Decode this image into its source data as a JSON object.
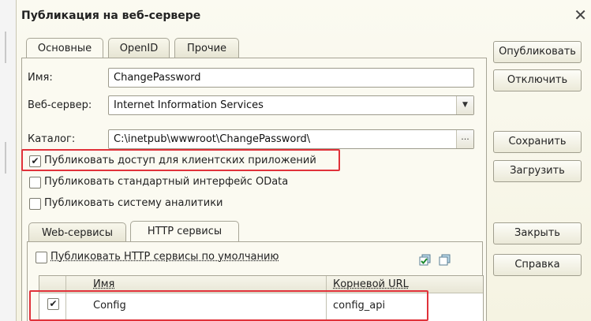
{
  "dialog": {
    "title": "Публикация на веб-сервере",
    "close_glyph": "✕"
  },
  "tabs": [
    {
      "label": "Основные",
      "active": true
    },
    {
      "label": "OpenID",
      "active": false
    },
    {
      "label": "Прочие",
      "active": false
    }
  ],
  "form": {
    "name_label": "Имя:",
    "name_value": "ChangePassword",
    "server_label": "Веб-сервер:",
    "server_value": "Internet Information Services",
    "catalog_label": "Каталог:",
    "catalog_value": "C:\\inetpub\\wwwroot\\ChangePassword\\",
    "ellipsis": "..."
  },
  "checkboxes": {
    "client_access": {
      "label": "Публиковать доступ для клиентских приложений",
      "checked": true
    },
    "odata": {
      "label": "Публиковать стандартный интерфейс OData",
      "checked": false
    },
    "analytics": {
      "label": "Публиковать систему аналитики",
      "checked": false
    }
  },
  "buttons": {
    "publish": "Опубликовать",
    "disable": "Отключить",
    "save": "Сохранить",
    "load": "Загрузить",
    "close": "Закрыть",
    "help": "Справка"
  },
  "inner_tabs": [
    {
      "label": "Web-сервисы",
      "active": false
    },
    {
      "label": "HTTP сервисы",
      "active": true
    }
  ],
  "http": {
    "default_label": "Публиковать HTTP сервисы по умолчанию",
    "default_checked": false,
    "columns": [
      "Имя",
      "Корневой URL"
    ],
    "rows": [
      {
        "checked": true,
        "name": "Config",
        "url": "config_api"
      }
    ]
  },
  "icons": {
    "check_all": "check-all-icon",
    "uncheck_all": "uncheck-all-icon"
  },
  "colors": {
    "highlight": "#e0323a",
    "dialog_bg": "#fbfaf1"
  }
}
